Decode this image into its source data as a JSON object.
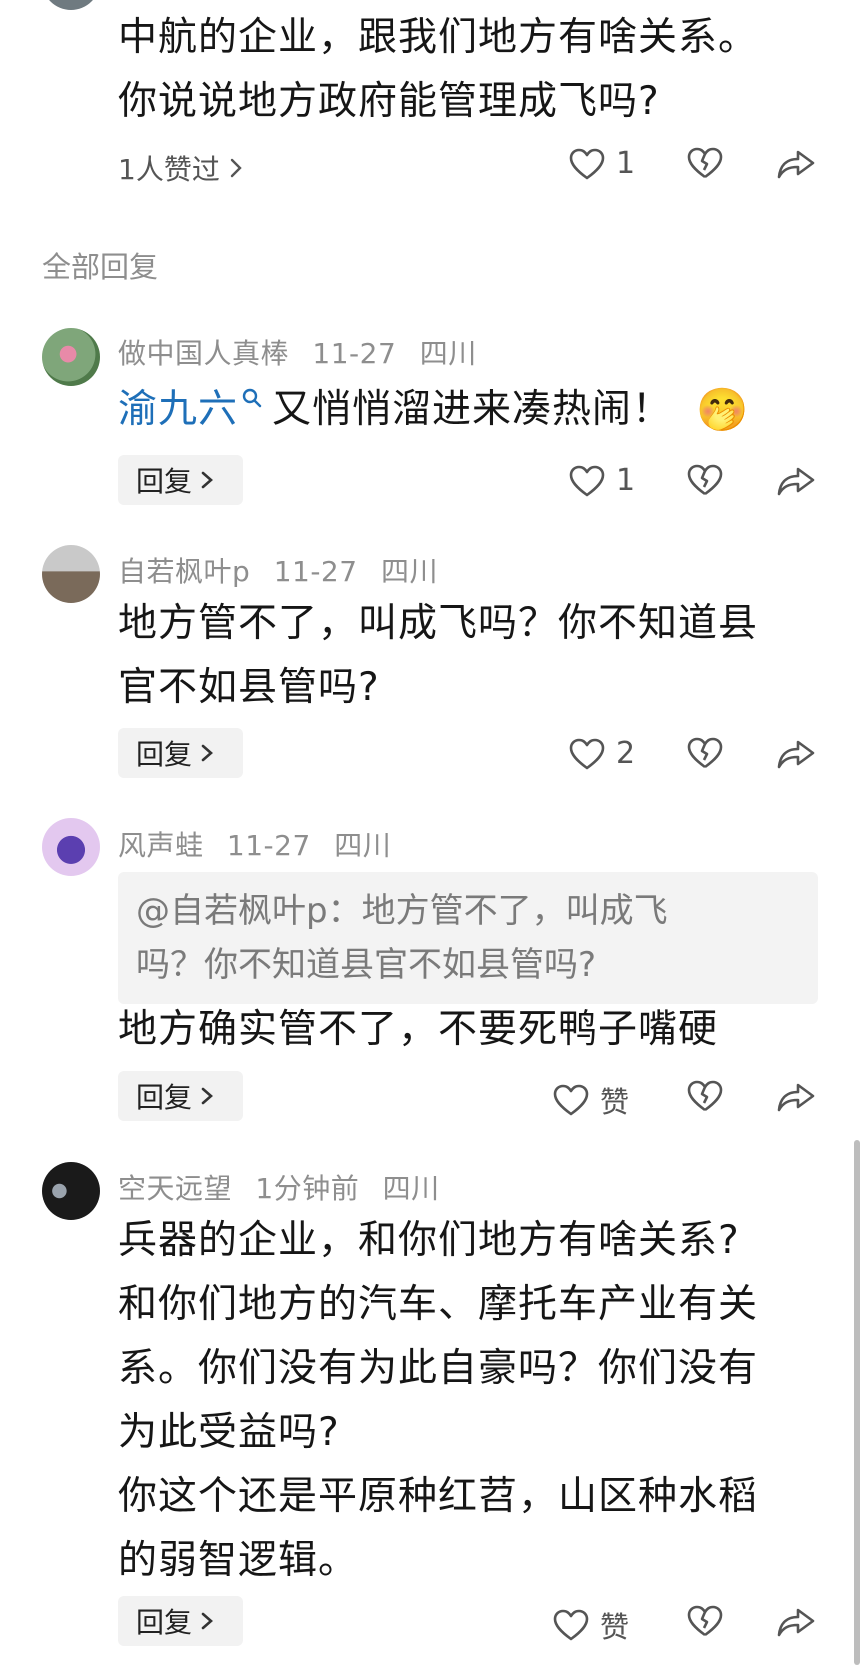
{
  "top_comment": {
    "lines": [
      "中航的企业，跟我们地方有啥关系。",
      "你说说地方政府能管理成飞吗?"
    ],
    "liked_by": "1人赞过",
    "like_count": "1"
  },
  "section_title": "全部回复",
  "replies": [
    {
      "author": "做中国人真棒",
      "date": "11-27",
      "location": "四川",
      "mention": "渝九六",
      "text": "又悄悄溜进来凑热闹！",
      "emoji": "🤭",
      "reply_label": "回复",
      "like_count": "1"
    },
    {
      "author": "自若枫叶p",
      "date": "11-27",
      "location": "四川",
      "lines": [
        "地方管不了，叫成飞吗？你不知道县",
        "官不如县管吗?"
      ],
      "reply_label": "回复",
      "like_count": "2"
    },
    {
      "author": "风声蛙",
      "date": "11-27",
      "location": "四川",
      "quote_lines": [
        "@自若枫叶p：地方管不了，叫成飞",
        "吗？你不知道县官不如县管吗?"
      ],
      "text": "地方确实管不了，不要死鸭子嘴硬",
      "reply_label": "回复",
      "like_label": "赞"
    },
    {
      "author": "空天远望",
      "date": "1分钟前",
      "location": "四川",
      "lines": [
        "兵器的企业，和你们地方有啥关系?",
        "和你们地方的汽车、摩托车产业有关",
        "系。你们没有为此自豪吗？你们没有",
        "为此受益吗?",
        "你这个还是平原种红苕，山区种水稻",
        "的弱智逻辑。"
      ],
      "reply_label": "回复",
      "like_label": "赞"
    }
  ],
  "icons": {
    "like": "heart-outline-icon",
    "dislike": "broken-heart-icon",
    "share": "share-arrow-icon",
    "search_hint": "search-icon"
  },
  "colors": {
    "mention": "#1e6fb8",
    "meta": "#8e8e8e"
  }
}
